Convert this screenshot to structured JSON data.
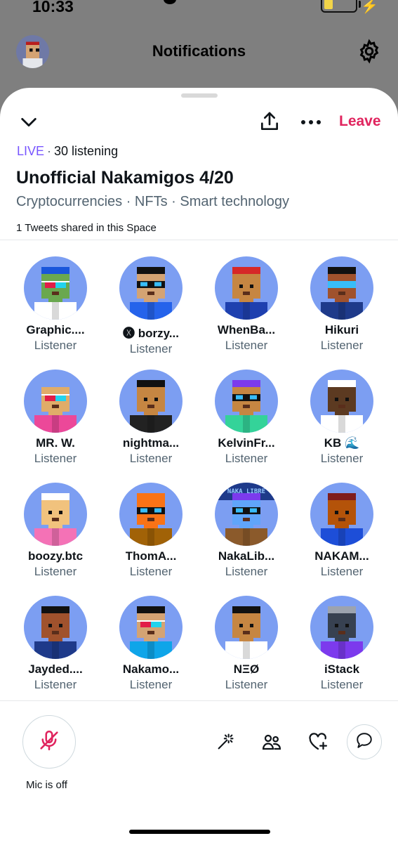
{
  "status": {
    "time": "10:33"
  },
  "header": {
    "title": "Notifications",
    "settings_icon": "gear-icon"
  },
  "space": {
    "live_label": "LIVE",
    "separator": "·",
    "listening": "30 listening",
    "title": "Unofficial Nakamigos 4/20",
    "topics": "Cryptocurrencies · NFTs · Smart technology",
    "tweets_shared": "1 Tweets shared in this Space",
    "leave_label": "Leave"
  },
  "participants": [
    {
      "name": "Graphic....",
      "role": "Listener",
      "skin": "#6aa84f",
      "hair": "#1a56db",
      "shirt": "#ffffff",
      "glasses": "3d"
    },
    {
      "name": "🅧 borzy...",
      "role": "Listener",
      "skin": "#d4a373",
      "hair": "#111111",
      "shirt": "#2563eb",
      "glasses": "shades"
    },
    {
      "name": "WhenBa...",
      "role": "Listener",
      "skin": "#c68642",
      "hair": "#d62828",
      "shirt": "#1e40af",
      "glasses": "none"
    },
    {
      "name": "Hikuri",
      "role": "Listener",
      "skin": "#a0522d",
      "hair": "#111111",
      "shirt": "#1e3a8a",
      "glasses": "visor"
    },
    {
      "name": "MR. W.",
      "role": "Listener",
      "skin": "#e0ac69",
      "hair": "#7c9ef2",
      "shirt": "#ec4899",
      "glasses": "3d"
    },
    {
      "name": "nightma...",
      "role": "Listener",
      "skin": "#c68642",
      "hair": "#111111",
      "shirt": "#222222",
      "glasses": "none"
    },
    {
      "name": "KelvinFr...",
      "role": "Listener",
      "skin": "#c68642",
      "hair": "#7c3aed",
      "shirt": "#34d399",
      "glasses": "shades"
    },
    {
      "name": "KB 🌊",
      "role": "Listener",
      "skin": "#5c3a21",
      "hair": "#ffffff",
      "shirt": "#ffffff",
      "glasses": "none"
    },
    {
      "name": "boozy.btc",
      "role": "Listener",
      "skin": "#f1c27d",
      "hair": "#ffffff",
      "shirt": "#f472b6",
      "glasses": "none"
    },
    {
      "name": "ThomA...",
      "role": "Listener",
      "skin": "#f97316",
      "hair": "#f97316",
      "shirt": "#a16207",
      "glasses": "shades"
    },
    {
      "name": "NakaLib...",
      "role": "Listener",
      "skin": "#60a5fa",
      "hair": "#7c3aed",
      "shirt": "#8b5a2b",
      "glasses": "shades",
      "badge": "NAKA LIBRE"
    },
    {
      "name": "NAKAM...",
      "role": "Listener",
      "skin": "#b45309",
      "hair": "#7f1d1d",
      "shirt": "#1d4ed8",
      "glasses": "none"
    },
    {
      "name": "Jayded....",
      "role": "Listener",
      "skin": "#a0522d",
      "hair": "#111111",
      "shirt": "#1e3a8a",
      "glasses": "none"
    },
    {
      "name": "Nakamo...",
      "role": "Listener",
      "skin": "#d4a373",
      "hair": "#111111",
      "shirt": "#0ea5e9",
      "glasses": "3d"
    },
    {
      "name": "NΞØ",
      "role": "Listener",
      "skin": "#c68642",
      "hair": "#111111",
      "shirt": "#ffffff",
      "glasses": "none"
    },
    {
      "name": "iStack",
      "role": "Listener",
      "skin": "#374151",
      "hair": "#9ca3af",
      "shirt": "#7c3aed",
      "glasses": "none"
    }
  ],
  "controls": {
    "mic_label": "Mic is off",
    "icons": [
      "mic-off-icon",
      "magic-wand-icon",
      "people-icon",
      "heart-plus-icon",
      "chat-bubble-icon"
    ]
  },
  "colors": {
    "live": "#7856ff",
    "leave": "#e0245e",
    "mic": "#e0245e",
    "avatar_bg": "#7c9ef2"
  }
}
